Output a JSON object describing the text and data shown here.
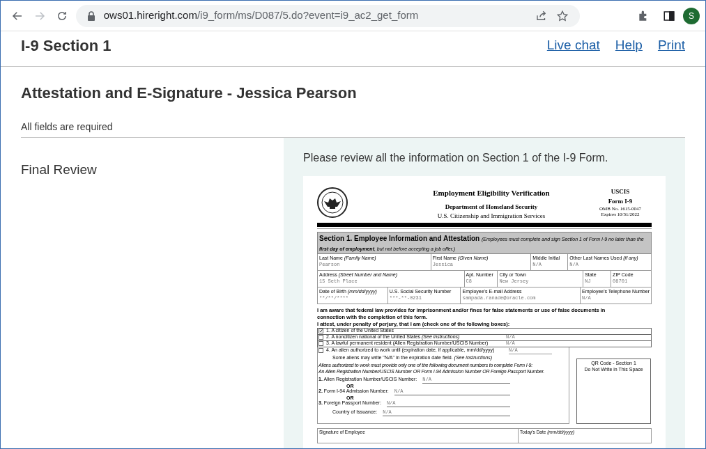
{
  "browser": {
    "url_host": "ows01.hireright.com",
    "url_path": "/i9_form/ms/D087/5.do?event=i9_ac2_get_form",
    "avatar": "S"
  },
  "header": {
    "title": "I-9 Section 1",
    "links": [
      "Live chat",
      "Help",
      "Print"
    ]
  },
  "page_heading": "Attestation and E-Signature - Jessica Pearson",
  "required_note": "All fields are required",
  "section_label": "Final Review",
  "review_prompt": "Please review all the information on Section 1 of the I-9 Form.",
  "form": {
    "title": "Employment Eligibility Verification",
    "department": "Department of Homeland Security",
    "agency": "U.S. Citizenship and Immigration Services",
    "agency_short": "USCIS",
    "form_name": "Form I-9",
    "omb": "OMB No. 1615-0047",
    "expires": "Expires 10/31/2022",
    "section_title": "Section 1. Employee Information and Attestation",
    "section_note": "(Employees must complete and sign Section 1 of Form I-9 no later than the **first day of employment**, but not before accepting a job offer.)",
    "field_rows": [
      [
        {
          "label": "Last Name *(Family Name)*",
          "value": "Pearson"
        },
        {
          "label": "First Name *(Given Name)*",
          "value": "Jessica"
        },
        {
          "label": "Middle Initial",
          "value": "N/A"
        },
        {
          "label": "Other Last Names Used *(if any)*",
          "value": "N/A"
        }
      ],
      [
        {
          "label": "Address *(Street Number and Name)*",
          "value": "15 Seth Place"
        },
        {
          "label": "Apt. Number",
          "value": "C8"
        },
        {
          "label": "City or Town",
          "value": "New Jersey"
        },
        {
          "label": "State",
          "value": "NJ"
        },
        {
          "label": "ZIP Code",
          "value": "08701"
        }
      ],
      [
        {
          "label": "Date of Birth *(mm/dd/yyyy)*",
          "value": "**/**/****"
        },
        {
          "label": "U.S. Social Security Number",
          "value": "***-**-0231"
        },
        {
          "label": "Employee's E-mail Address",
          "value": "sampada.ranade@oracle.com"
        },
        {
          "label": "Employee's Telephone Number",
          "value": "N/A"
        }
      ]
    ],
    "awareness": "I am aware that federal law provides for imprisonment and/or fines for false statements or use of false documents in connection with the completion of this form.",
    "attest": "I attest, under penalty of perjury, that I am (check one of the following boxes):",
    "options": [
      {
        "label": "1. A citizen of the United States",
        "checked": true
      },
      {
        "label": "2. A noncitizen national of the United States *(See instructions)*",
        "value": "N/A",
        "checked": false
      },
      {
        "label": "3. A lawful permanent resident (Alien Registration Number/USCIS Number)",
        "value": "N/A",
        "checked": false
      },
      {
        "label": "4. An alien authorized to work until (expiration date, if applicable, mm/dd/yyyy)",
        "value": "N/A",
        "checked": false
      }
    ],
    "option_note": "Some aliens may write \"N/A\" in the expiration date field. *(See instructions)*",
    "alien_note": [
      "Aliens authorized to work must provide only one of the following document numbers to complete Form I-9:",
      "An Alien Registration Number/USCIS Number OR Form I-94 Admission Number OR Foreign Passport Number."
    ],
    "documents": [
      {
        "kind": "field",
        "label": "**1.** Alien Registration Number/USCIS Number:",
        "value": "N/A"
      },
      {
        "kind": "or",
        "label": "OR"
      },
      {
        "kind": "field",
        "label": "**2.** Form I-94 Admission Number:",
        "value": "N/A"
      },
      {
        "kind": "or",
        "label": "OR"
      },
      {
        "kind": "field",
        "label": "**3.** Foreign Passport Number:",
        "value": "N/A"
      },
      {
        "kind": "subfield",
        "label": "Country of Issuance:",
        "value": "N/A"
      }
    ],
    "qr_box": [
      "QR Code - Section 1",
      "Do Not Write in This Space"
    ],
    "signature_label": "Signature of Employee",
    "date_label": "Today's Date *(mm/dd/yyyy)*"
  }
}
